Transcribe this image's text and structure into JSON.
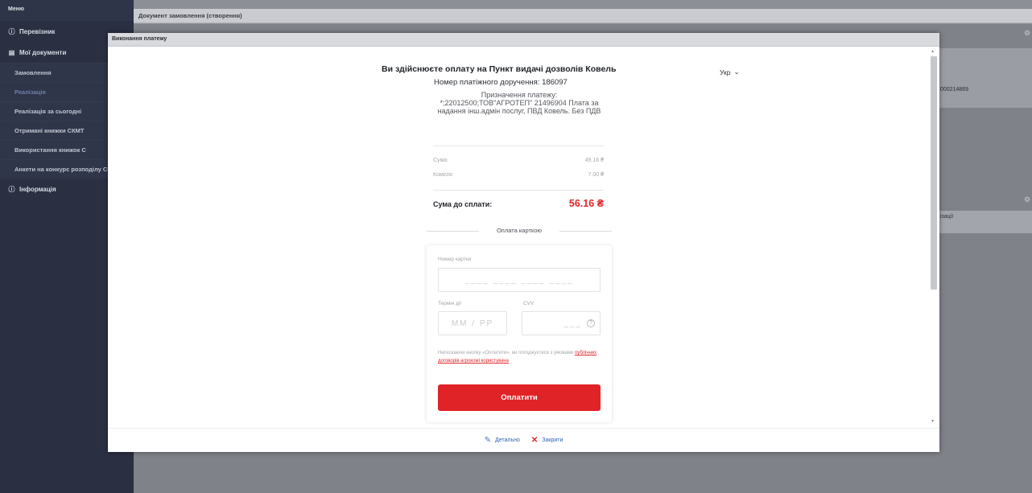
{
  "sidebar": {
    "title": "Меню",
    "sections": [
      {
        "label": "Перевізник",
        "icon": "info-circle-icon"
      },
      {
        "label": "Мої документи",
        "icon": "document-icon"
      }
    ],
    "items": [
      {
        "label": "Замовлення"
      },
      {
        "label": "Реалізація"
      },
      {
        "label": "Реалізація за сьогодні"
      },
      {
        "label": "Отримані книжки СКМТ"
      },
      {
        "label": "Використання книжок С"
      },
      {
        "label": "Анкети на конкурс розподілу СКМТ"
      }
    ],
    "info_section": {
      "label": "Інформація",
      "icon": "info-circle-icon"
    }
  },
  "main": {
    "title": "Документ замовлення (створення)",
    "bg_value": "000214869",
    "bg_label": "ізації"
  },
  "dialog": {
    "title": "Виконання платежу",
    "payee_prefix": "Ви здійснюєте оплату на ",
    "payee_name": "Пункт видачі дозволів Ковель",
    "order_label": "Номер платіжного доручення: ",
    "order_number": "186097",
    "purpose_label": "Призначення платежу:",
    "purpose_text": "*;22012500;ТОВ\"АГРОТЕП\" 21496904 Плата за надання інш.адмін послуг, ПВД Ковель. Без ПДВ",
    "language": "Укр",
    "amount_label": "Сума:",
    "amount_value": "49.16 ₴",
    "fee_label": "Комісія:",
    "fee_value": "7.00 ₴",
    "total_label": "Сума до сплати:",
    "total_value": "56.16 ₴",
    "card_section_label": "Оплата карткою",
    "card_number_label": "Номер картки",
    "card_number_placeholder": "____ ____ ____ ____",
    "expiry_label": "Термін дії",
    "expiry_placeholder": "ММ / РР",
    "cvv_label": "CVV",
    "cvv_placeholder": "___",
    "terms_text": "Натискаючи кнопку «Оплатити», ви погоджуєтеся з умовами ",
    "terms_link": "публічних договорів агрокомі користувача",
    "pay_button": "Оплатити",
    "details_button": "Детально",
    "close_button": "Закрити"
  },
  "colors": {
    "accent_red": "#e02327",
    "sidebar_bg": "#2a3042",
    "link_blue": "#2e64b3"
  }
}
